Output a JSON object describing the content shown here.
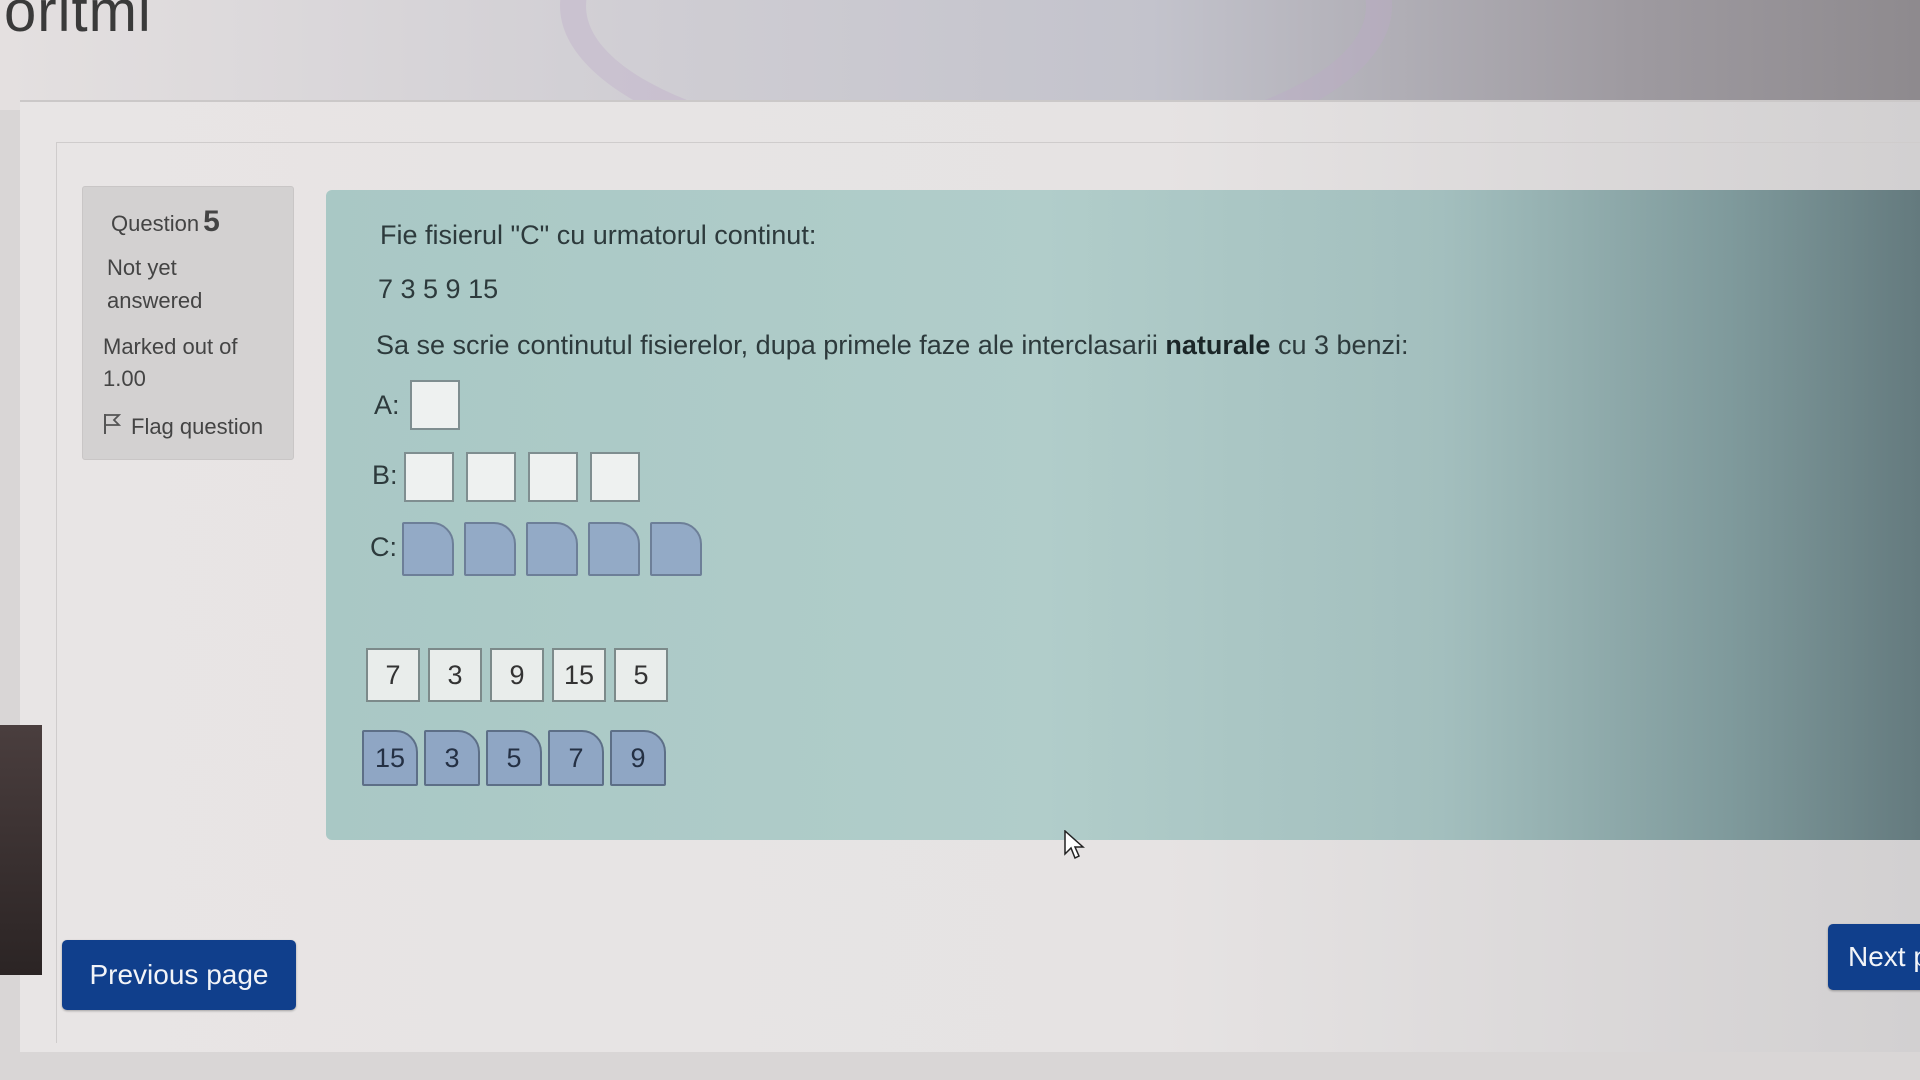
{
  "site": {
    "title": "oritmi"
  },
  "question_info": {
    "question_word": "Question",
    "question_number": "5",
    "state": "Not yet answered",
    "marked_out_of": "Marked out of 1.00",
    "flag_label": "Flag question"
  },
  "question": {
    "intro": "Fie fisierul \"C\" cu urmatorul continut:",
    "content": "7 3 5 9 15",
    "instruction_before": "Sa se scrie continutul fisierelor, dupa primele faze ale interclasarii ",
    "instruction_bold": "naturale",
    "instruction_after": " cu 3 benzi:",
    "rows": {
      "a_label": "A:",
      "b_label": "B:",
      "c_label": "C:"
    }
  },
  "drag_items": {
    "white": [
      "7",
      "3",
      "9",
      "15",
      "5"
    ],
    "blue": [
      "15",
      "3",
      "5",
      "7",
      "9"
    ]
  },
  "navigation": {
    "previous_label": "Previous page",
    "next_label": "Next p"
  },
  "colors": {
    "button": "#103f8c",
    "content_bg": "#a9c8c5",
    "blue_tile": "#8fa6c4"
  }
}
